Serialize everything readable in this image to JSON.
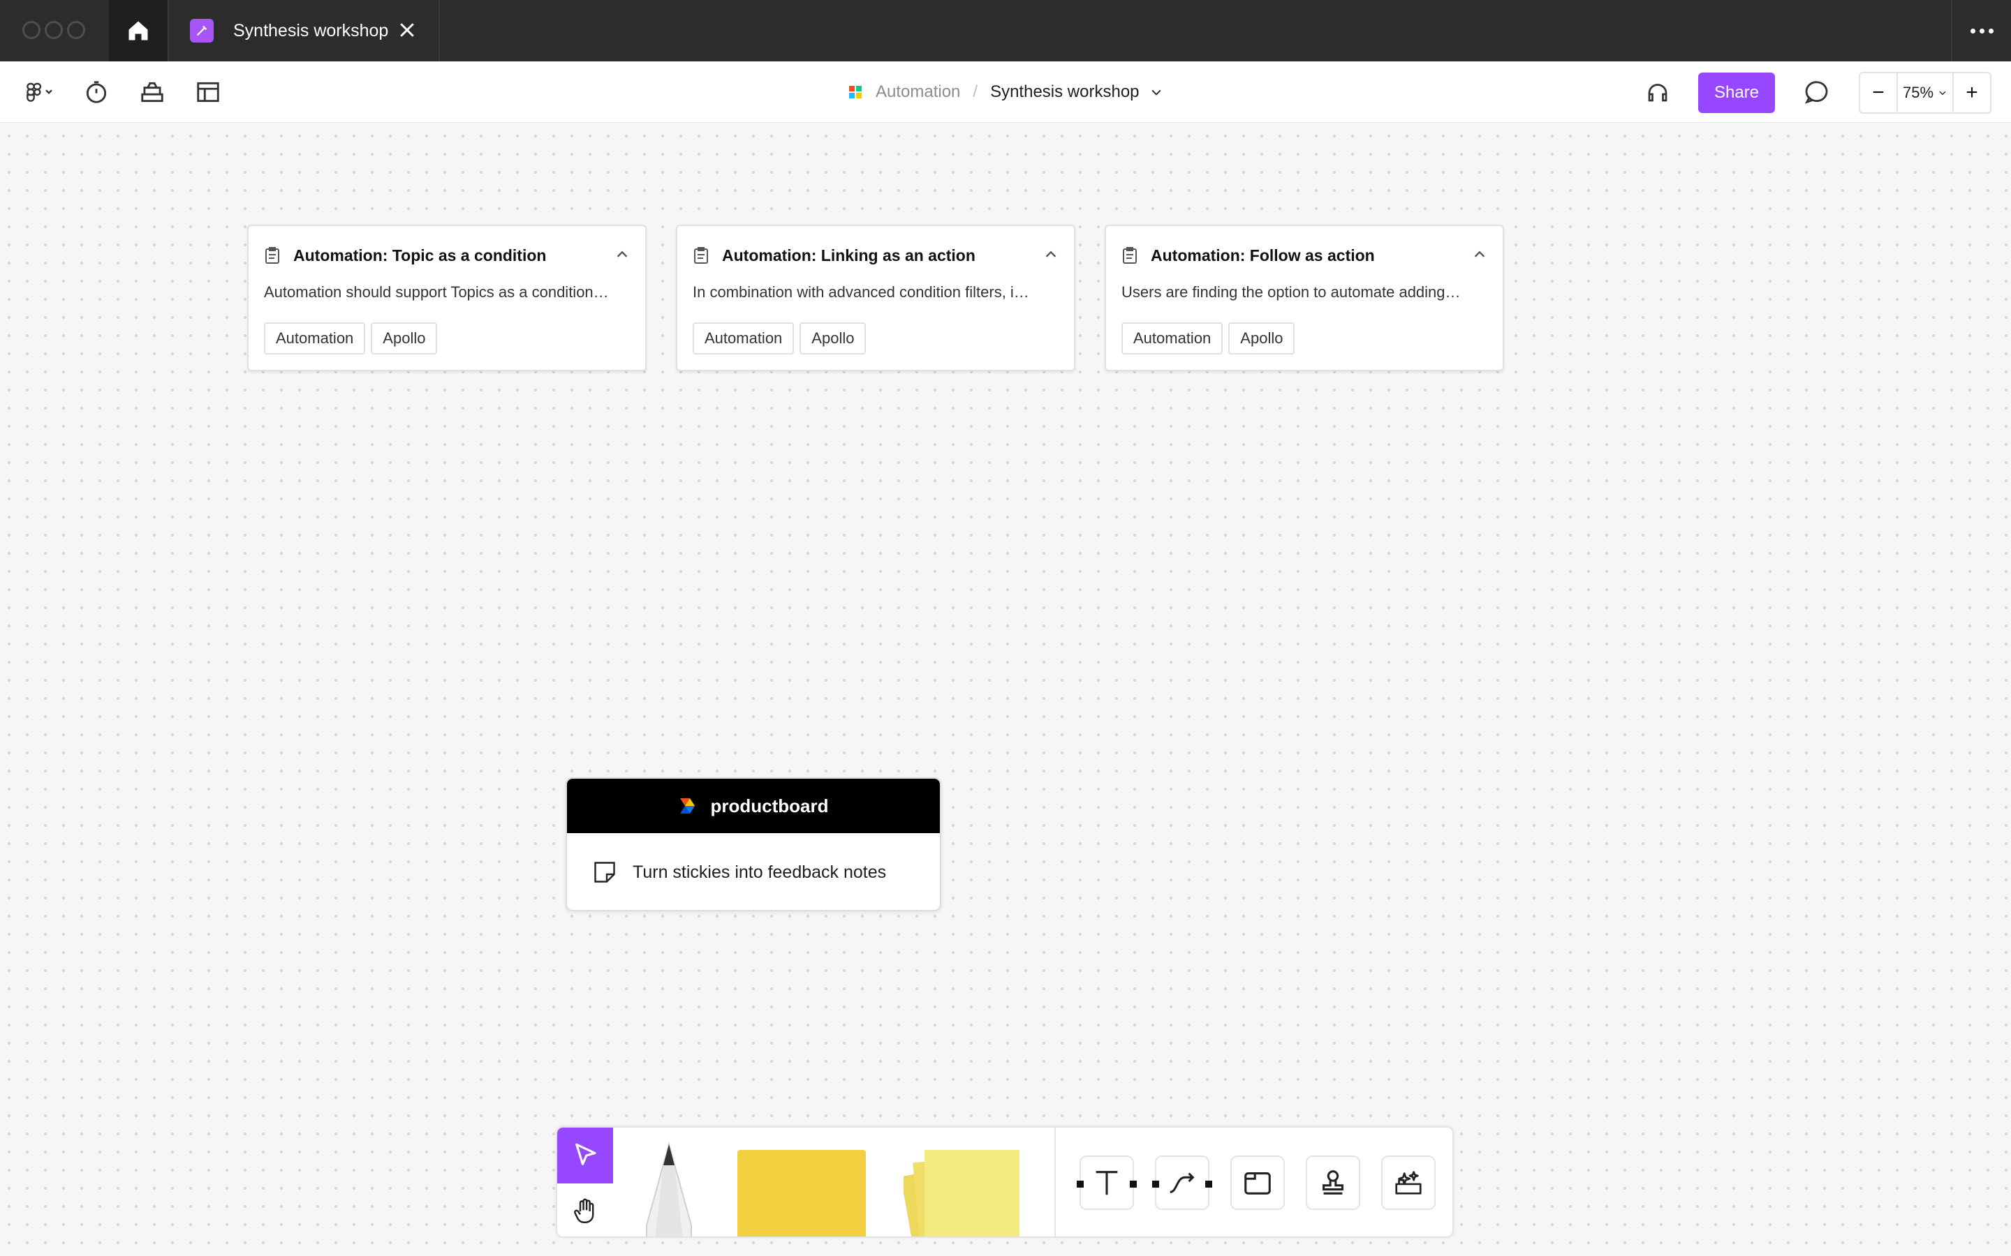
{
  "app": {
    "tab_title": "Synthesis workshop",
    "accent_color": "#9747ff"
  },
  "toolbar": {
    "left_icons": [
      "figjam-menu-icon",
      "timer-icon",
      "stamp-tray-icon",
      "layout-icon"
    ],
    "breadcrumb": {
      "parent": "Automation",
      "separator": "/",
      "current": "Synthesis workshop"
    },
    "share_label": "Share",
    "zoom": {
      "minus": "−",
      "value": "75%",
      "plus": "+"
    }
  },
  "cards": [
    {
      "title": "Automation: Topic as a condition",
      "description": "Automation should support Topics as a condition…",
      "tags": [
        "Automation",
        "Apollo"
      ]
    },
    {
      "title": "Automation: Linking as an action",
      "description": "In combination with advanced condition filters, i…",
      "tags": [
        "Automation",
        "Apollo"
      ]
    },
    {
      "title": "Automation: Follow as action",
      "description": "Users are finding the option to automate adding…",
      "tags": [
        "Automation",
        "Apollo"
      ]
    }
  ],
  "widget": {
    "brand": "productboard",
    "action_label": "Turn stickies into feedback notes"
  },
  "palette": {
    "tools": [
      "select-tool",
      "hand-tool",
      "pen-tool",
      "sticky-note-tool",
      "sticky-stack-tool",
      "text-tool",
      "connector-tool",
      "section-tool",
      "stamp-tool",
      "widgets-tool"
    ],
    "sticky_color": "#f2d040",
    "sticky_stack_color": "#f5ea80"
  }
}
